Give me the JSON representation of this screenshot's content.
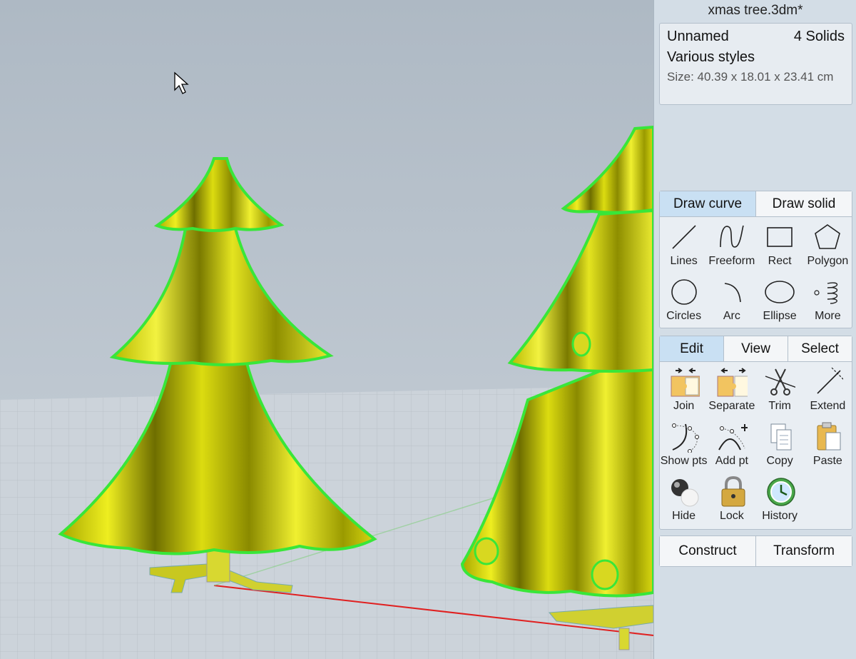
{
  "document": {
    "title": "xmas tree.3dm*",
    "object_name": "Unnamed",
    "object_count": "4 Solids",
    "styles": "Various styles",
    "size": "Size: 40.39 x 18.01 x 23.41 cm"
  },
  "draw_panel": {
    "tabs": [
      {
        "label": "Draw curve",
        "active": true
      },
      {
        "label": "Draw solid",
        "active": false
      }
    ],
    "tools": [
      {
        "label": "Lines",
        "icon": "line-icon"
      },
      {
        "label": "Freeform",
        "icon": "freeform-icon"
      },
      {
        "label": "Rect",
        "icon": "rectangle-icon"
      },
      {
        "label": "Polygon",
        "icon": "polygon-icon"
      },
      {
        "label": "Circles",
        "icon": "circle-icon"
      },
      {
        "label": "Arc",
        "icon": "arc-icon"
      },
      {
        "label": "Ellipse",
        "icon": "ellipse-icon"
      },
      {
        "label": "More",
        "icon": "spiral-icon"
      }
    ]
  },
  "edit_panel": {
    "tabs": [
      {
        "label": "Edit",
        "active": true
      },
      {
        "label": "View",
        "active": false
      },
      {
        "label": "Select",
        "active": false
      }
    ],
    "tools": [
      {
        "label": "Join",
        "icon": "join-icon"
      },
      {
        "label": "Separate",
        "icon": "separate-icon"
      },
      {
        "label": "Trim",
        "icon": "scissors-icon"
      },
      {
        "label": "Extend",
        "icon": "extend-icon"
      },
      {
        "label": "Show pts",
        "icon": "show-points-icon"
      },
      {
        "label": "Add pt",
        "icon": "add-point-icon"
      },
      {
        "label": "Copy",
        "icon": "copy-icon"
      },
      {
        "label": "Paste",
        "icon": "paste-icon"
      },
      {
        "label": "Hide",
        "icon": "hide-icon"
      },
      {
        "label": "Lock",
        "icon": "lock-icon"
      },
      {
        "label": "History",
        "icon": "history-icon"
      }
    ]
  },
  "bottom_panel": {
    "tabs": [
      {
        "label": "Construct"
      },
      {
        "label": "Transform"
      }
    ]
  },
  "colors": {
    "model_fill": "#c8c800",
    "selection_highlight": "#39e639",
    "tab_active": "#c9e0f3",
    "panel_bg": "#d3dde6"
  }
}
